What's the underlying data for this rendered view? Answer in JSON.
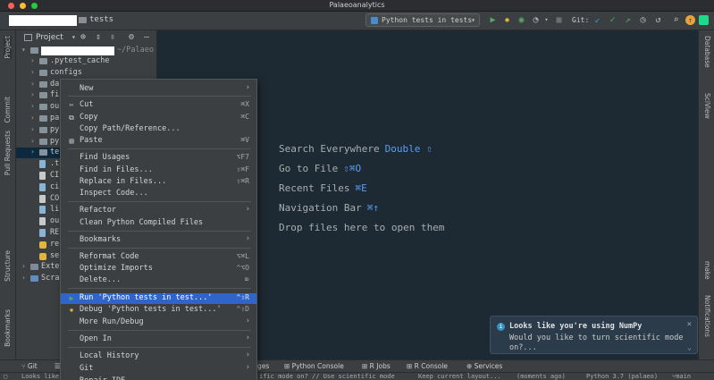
{
  "window": {
    "title": "Palaeoanalytics"
  },
  "toolbar": {
    "project_name": "tests",
    "run_config": "Python tests in tests",
    "git_label": "Git:"
  },
  "left_tabs": {
    "project": "Project",
    "commit": "Commit",
    "pull_requests": "Pull Requests",
    "structure": "Structure",
    "bookmarks": "Bookmarks"
  },
  "right_tabs": {
    "database": "Database",
    "sciview": "SciView",
    "make": "make",
    "notifications": "Notifications"
  },
  "project_panel": {
    "title": "Project",
    "root_path": "~/Palaeo",
    "items": [
      {
        "label": ".pytest_cache",
        "kind": "folder"
      },
      {
        "label": "configs",
        "kind": "folder"
      },
      {
        "label": "da",
        "kind": "folder"
      },
      {
        "label": "fi",
        "kind": "folder"
      },
      {
        "label": "ou",
        "kind": "folder"
      },
      {
        "label": "pa",
        "kind": "folder"
      },
      {
        "label": "py",
        "kind": "folder"
      },
      {
        "label": "py",
        "kind": "folder"
      },
      {
        "label": "te",
        "kind": "folder"
      },
      {
        "label": ".t",
        "kind": "file"
      },
      {
        "label": "CI",
        "kind": "file"
      },
      {
        "label": "ci",
        "kind": "file"
      },
      {
        "label": "CO",
        "kind": "file"
      },
      {
        "label": "li",
        "kind": "file"
      },
      {
        "label": "ou",
        "kind": "file"
      },
      {
        "label": "RE",
        "kind": "file"
      },
      {
        "label": "re",
        "kind": "py"
      },
      {
        "label": "se",
        "kind": "py"
      },
      {
        "label": "Exte",
        "kind": "lib"
      },
      {
        "label": "Scra",
        "kind": "scratch"
      }
    ]
  },
  "editor_hints": [
    {
      "text": "Search Everywhere",
      "key": "Double ⇧"
    },
    {
      "text": "Go to File",
      "key": "⇧⌘O"
    },
    {
      "text": "Recent Files",
      "key": "⌘E"
    },
    {
      "text": "Navigation Bar",
      "key": "⌘↑"
    },
    {
      "text": "Drop files here to open them",
      "key": ""
    }
  ],
  "context_menu": {
    "items": [
      {
        "label": "New",
        "key": "",
        "submenu": true
      },
      {
        "label": "Cut",
        "key": "⌘X",
        "icon": "✂"
      },
      {
        "label": "Copy",
        "key": "⌘C",
        "icon": "⧉"
      },
      {
        "label": "Copy Path/Reference...",
        "key": ""
      },
      {
        "label": "Paste",
        "key": "⌘V",
        "icon": "📋"
      },
      {
        "label": "Find Usages",
        "key": "⌥F7"
      },
      {
        "label": "Find in Files...",
        "key": "⇧⌘F"
      },
      {
        "label": "Replace in Files...",
        "key": "⇧⌘R"
      },
      {
        "label": "Inspect Code...",
        "key": ""
      },
      {
        "label": "Refactor",
        "key": "",
        "submenu": true
      },
      {
        "label": "Clean Python Compiled Files",
        "key": ""
      },
      {
        "label": "Bookmarks",
        "key": "",
        "submenu": true
      },
      {
        "label": "Reformat Code",
        "key": "⌥⌘L"
      },
      {
        "label": "Optimize Imports",
        "key": "^⌥O"
      },
      {
        "label": "Delete...",
        "key": "⌦"
      },
      {
        "label": "Run 'Python tests in test...'",
        "key": "^⇧R",
        "icon": "▶"
      },
      {
        "label": "Debug 'Python tests in test...'",
        "key": "^⇧D",
        "icon": "🐞"
      },
      {
        "label": "More Run/Debug",
        "key": "",
        "submenu": true
      },
      {
        "label": "Open In",
        "key": "",
        "submenu": true
      },
      {
        "label": "Local History",
        "key": "",
        "submenu": true
      },
      {
        "label": "Git",
        "key": "",
        "submenu": true
      },
      {
        "label": "Repair IDE",
        "key": ""
      }
    ]
  },
  "notification": {
    "title": "Looks like you're using NumPy",
    "body": "Would you like to turn scientific mode on?..."
  },
  "bottom_bar": {
    "git": "Git",
    "ges": "ges",
    "python_console": "Python Console",
    "r_jobs": "R Jobs",
    "r_console": "R Console",
    "services": "Services"
  },
  "status_bar": {
    "left": "Looks like",
    "middle": "ific mode on? // Use scientific mode",
    "keep": "Keep current layout...",
    "ago": "(moments ago)",
    "interpreter": "Python 3.7 (palaeo)",
    "branch": "main"
  },
  "colors": {
    "accent": "#2f65ca",
    "link": "#589df6",
    "background": "#1e2a33",
    "panel": "#3c3f41"
  }
}
